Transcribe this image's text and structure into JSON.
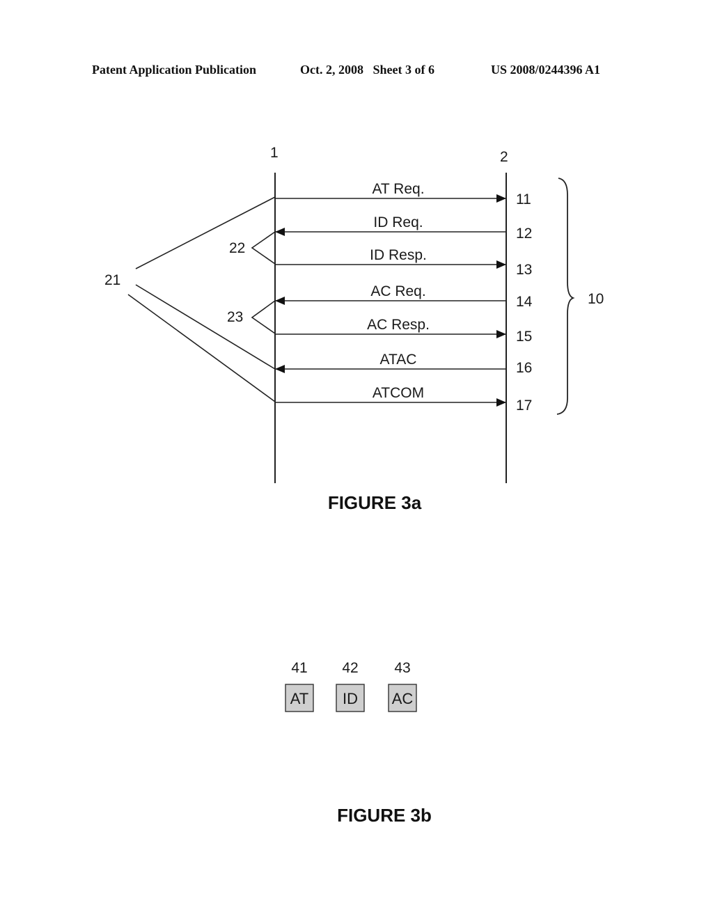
{
  "header": {
    "publication": "Patent Application Publication",
    "date_sheet": "Oct. 2, 2008   Sheet 3 of 6",
    "patent_number": "US 2008/0244396 A1"
  },
  "figure_3a": {
    "caption": "FIGURE 3a",
    "entities": [
      {
        "ref": "1"
      },
      {
        "ref": "2"
      }
    ],
    "messages": [
      {
        "label": "AT Req.",
        "ref": "11",
        "direction": "right"
      },
      {
        "label": "ID Req.",
        "ref": "12",
        "direction": "left"
      },
      {
        "label": "ID Resp.",
        "ref": "13",
        "direction": "right"
      },
      {
        "label": "AC Req.",
        "ref": "14",
        "direction": "left"
      },
      {
        "label": "AC Resp.",
        "ref": "15",
        "direction": "right"
      },
      {
        "label": "ATAC",
        "ref": "16",
        "direction": "left"
      },
      {
        "label": "ATCOM",
        "ref": "17",
        "direction": "right"
      }
    ],
    "group_refs": {
      "all_messages": "10",
      "outer_group": "21",
      "id_pair": "22",
      "ac_pair": "23"
    }
  },
  "figure_3b": {
    "caption": "FIGURE 3b",
    "boxes": [
      {
        "ref": "41",
        "label": "AT"
      },
      {
        "ref": "42",
        "label": "ID"
      },
      {
        "ref": "43",
        "label": "AC"
      }
    ],
    "box_fill": "#cfcfcf"
  }
}
